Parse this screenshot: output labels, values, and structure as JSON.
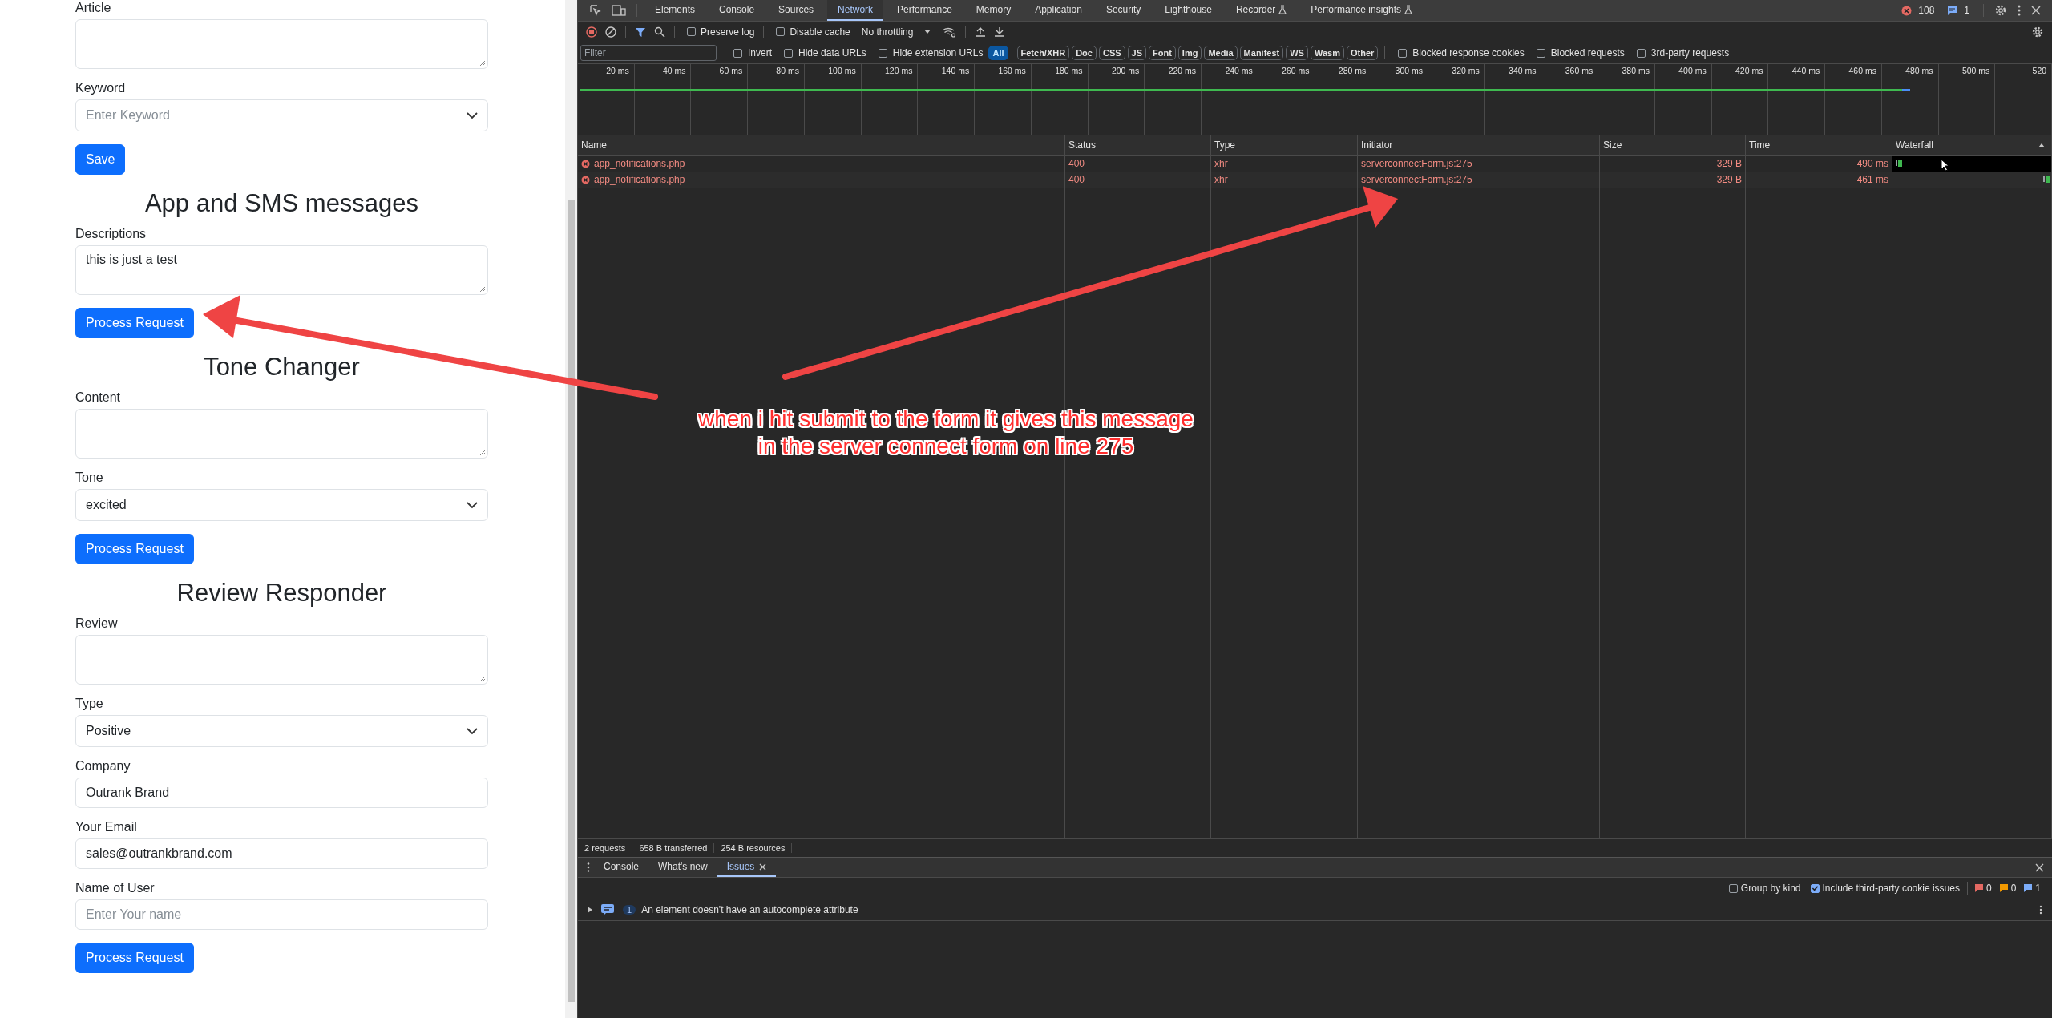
{
  "form": {
    "items": [
      {
        "kind": "textarea",
        "label": "Article"
      },
      {
        "kind": "select",
        "label": "Keyword",
        "placeholder": "Enter Keyword"
      },
      {
        "kind": "button",
        "label": "Save"
      },
      {
        "kind": "heading",
        "label": "App and SMS messages"
      },
      {
        "kind": "textarea",
        "label": "Descriptions",
        "value": "this is just a test"
      },
      {
        "kind": "button",
        "label": "Process Request"
      },
      {
        "kind": "heading",
        "label": "Tone Changer"
      },
      {
        "kind": "textarea",
        "label": "Content"
      },
      {
        "kind": "select",
        "label": "Tone",
        "value": "excited"
      },
      {
        "kind": "button",
        "label": "Process Request"
      },
      {
        "kind": "heading",
        "label": "Review Responder"
      },
      {
        "kind": "textarea",
        "label": "Review"
      },
      {
        "kind": "select",
        "label": "Type",
        "value": "Positive"
      },
      {
        "kind": "input",
        "label": "Company",
        "value": "Outrank Brand"
      },
      {
        "kind": "input",
        "label": "Your Email",
        "value": "sales@outrankbrand.com"
      },
      {
        "kind": "input",
        "label": "Name of User",
        "placeholder": "Enter Your name"
      },
      {
        "kind": "button",
        "label": "Process Request"
      }
    ]
  },
  "devtools": {
    "tabs": [
      {
        "label": "Elements",
        "selected": false,
        "experimental": false
      },
      {
        "label": "Console",
        "selected": false,
        "experimental": false
      },
      {
        "label": "Sources",
        "selected": false,
        "experimental": false
      },
      {
        "label": "Network",
        "selected": true,
        "experimental": false
      },
      {
        "label": "Performance",
        "selected": false,
        "experimental": false
      },
      {
        "label": "Memory",
        "selected": false,
        "experimental": false
      },
      {
        "label": "Application",
        "selected": false,
        "experimental": false
      },
      {
        "label": "Security",
        "selected": false,
        "experimental": false
      },
      {
        "label": "Lighthouse",
        "selected": false,
        "experimental": false
      },
      {
        "label": "Recorder",
        "selected": false,
        "experimental": true
      },
      {
        "label": "Performance insights",
        "selected": false,
        "experimental": true
      }
    ],
    "error_count": "108",
    "issue_count": "1",
    "toolbar": {
      "preserve_log": {
        "label": "Preserve log",
        "checked": false
      },
      "disable_cache": {
        "label": "Disable cache",
        "checked": false
      },
      "throttling": "No throttling"
    },
    "filter": {
      "placeholder": "Filter",
      "options": [
        {
          "label": "Invert",
          "checked": false
        },
        {
          "label": "Hide data URLs",
          "checked": false
        },
        {
          "label": "Hide extension URLs",
          "checked": false
        }
      ],
      "types": [
        {
          "label": "All",
          "selected": true
        },
        {
          "label": "Fetch/XHR",
          "selected": false
        },
        {
          "label": "Doc",
          "selected": false
        },
        {
          "label": "CSS",
          "selected": false
        },
        {
          "label": "JS",
          "selected": false
        },
        {
          "label": "Font",
          "selected": false
        },
        {
          "label": "Img",
          "selected": false
        },
        {
          "label": "Media",
          "selected": false
        },
        {
          "label": "Manifest",
          "selected": false
        },
        {
          "label": "WS",
          "selected": false
        },
        {
          "label": "Wasm",
          "selected": false
        },
        {
          "label": "Other",
          "selected": false
        }
      ],
      "extra": [
        {
          "label": "Blocked response cookies",
          "checked": false
        },
        {
          "label": "Blocked requests",
          "checked": false
        },
        {
          "label": "3rd-party requests",
          "checked": false
        }
      ]
    },
    "timeline_ticks": [
      "20 ms",
      "40 ms",
      "60 ms",
      "80 ms",
      "100 ms",
      "120 ms",
      "140 ms",
      "160 ms",
      "180 ms",
      "200 ms",
      "220 ms",
      "240 ms",
      "260 ms",
      "280 ms",
      "300 ms",
      "320 ms",
      "340 ms",
      "360 ms",
      "380 ms",
      "400 ms",
      "420 ms",
      "440 ms",
      "460 ms",
      "480 ms",
      "500 ms",
      "520"
    ],
    "table": {
      "columns": [
        "Name",
        "Status",
        "Type",
        "Initiator",
        "Size",
        "Time",
        "Waterfall"
      ],
      "rows": [
        {
          "name": "app_notifications.php",
          "status": "400",
          "type": "xhr",
          "initiator": "serverconnectForm.js:275",
          "size": "329 B",
          "time": "490 ms",
          "error": true
        },
        {
          "name": "app_notifications.php",
          "status": "400",
          "type": "xhr",
          "initiator": "serverconnectForm.js:275",
          "size": "329 B",
          "time": "461 ms",
          "error": true
        }
      ]
    },
    "status_bar": [
      "2 requests",
      "658 B transferred",
      "254 B resources"
    ],
    "drawer": {
      "tabs": [
        {
          "label": "Console",
          "selected": false
        },
        {
          "label": "What's new",
          "selected": false
        },
        {
          "label": "Issues",
          "selected": true
        }
      ],
      "group_by_kind": {
        "label": "Group by kind",
        "checked": false
      },
      "third_party": {
        "label": "Include third-party cookie issues",
        "checked": true
      },
      "counts": [
        "0",
        "0",
        "1"
      ],
      "issues": [
        {
          "count": "1",
          "text": "An element doesn't have an autocomplete attribute"
        }
      ]
    }
  },
  "annotation": {
    "lines": [
      "when i hit submit to the form it gives this message",
      "in the server connect form on line 275"
    ]
  }
}
